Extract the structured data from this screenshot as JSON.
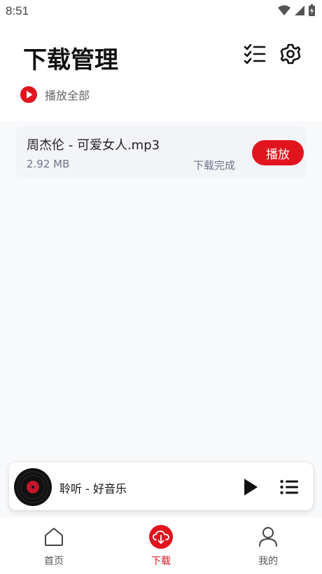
{
  "status_bar": {
    "time": "8:51"
  },
  "header": {
    "title": "下载管理",
    "play_all_label": "播放全部"
  },
  "downloads": [
    {
      "title": "周杰伦 - 可爱女人.mp3",
      "size": "2.92 MB",
      "status": "下载完成",
      "play_label": "播放"
    }
  ],
  "mini_player": {
    "title": "聆听 - 好音乐"
  },
  "tabs": [
    {
      "label": "首页",
      "icon": "home-icon",
      "active": false
    },
    {
      "label": "下载",
      "icon": "cloud-download-icon",
      "active": true
    },
    {
      "label": "我的",
      "icon": "user-icon",
      "active": false
    }
  ],
  "colors": {
    "accent": "#e1141e",
    "background": "#f8f9fb",
    "card": "#f3f4f8",
    "muted_text": "#707587"
  }
}
